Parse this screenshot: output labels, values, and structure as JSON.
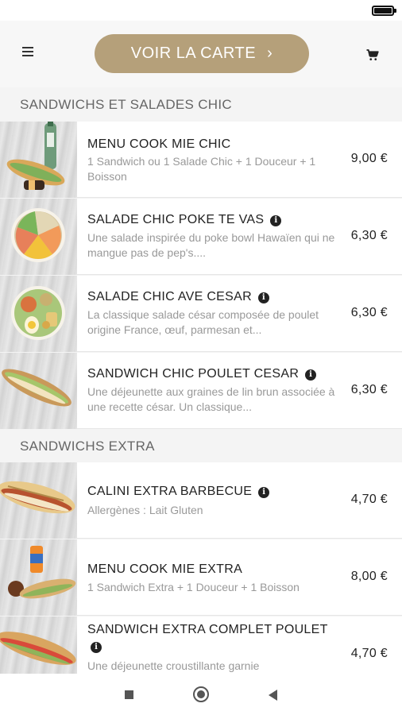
{
  "header": {
    "cta_label": "VOIR LA CARTE",
    "cta_chevron": "›",
    "menu_icon": "hamburger-menu-icon",
    "cart_icon": "shopping-cart-icon"
  },
  "colors": {
    "accent": "#b5a07a",
    "text": "#222222",
    "muted": "#999999",
    "section_text": "#666666"
  },
  "sections": [
    {
      "title": "SANDWICHS ET SALADES CHIC",
      "items": [
        {
          "name": "MENU COOK MIE CHIC",
          "has_info": false,
          "description": "1 Sandwich ou 1 Salade Chic + 1 Douceur + 1 Boisson",
          "price": "9,00 €"
        },
        {
          "name": "SALADE CHIC POKE TE VAS",
          "has_info": true,
          "description": "Une salade inspirée du poke bowl Hawaïen qui ne mangue pas de pep's....",
          "price": "6,30 €"
        },
        {
          "name": "SALADE CHIC AVE CESAR",
          "has_info": true,
          "description": "La classique salade césar composée de poulet origine France, œuf, parmesan et...",
          "price": "6,30 €"
        },
        {
          "name": "SANDWICH CHIC POULET CESAR",
          "has_info": true,
          "description": "Une déjeunette aux graines de lin brun associée à une recette césar. Un classique...",
          "price": "6,30 €"
        }
      ]
    },
    {
      "title": "SANDWICHS EXTRA",
      "items": [
        {
          "name": "CALINI EXTRA BARBECUE",
          "has_info": true,
          "description": "Allergènes : Lait Gluten",
          "price": "4,70 €"
        },
        {
          "name": "MENU COOK MIE EXTRA",
          "has_info": false,
          "description": "1 Sandwich Extra + 1 Douceur + 1 Boisson",
          "price": "8,00 €"
        },
        {
          "name": "SANDWICH EXTRA COMPLET POULET",
          "has_info": true,
          "description": "Une déjeunette croustillante garnie",
          "price": "4,70 €"
        }
      ]
    }
  ],
  "info_glyph": "i",
  "system": {
    "nav_icons": [
      "recents-square-icon",
      "home-circle-icon",
      "back-triangle-icon"
    ]
  }
}
